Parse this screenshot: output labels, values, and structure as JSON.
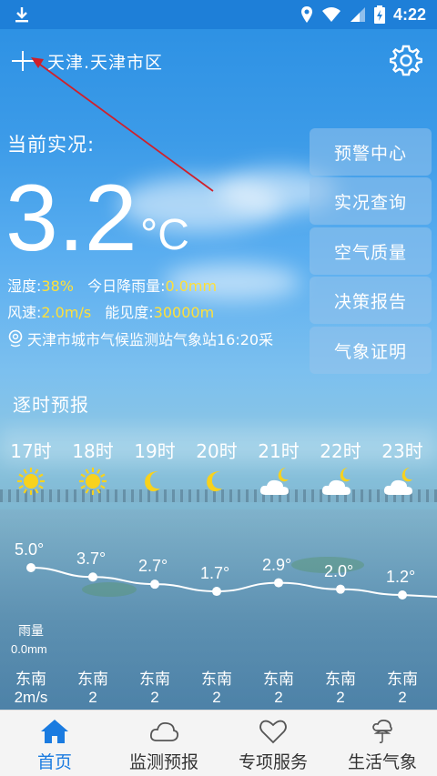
{
  "status_bar": {
    "time": "4:22"
  },
  "header": {
    "location": "天津.天津市区"
  },
  "current": {
    "label": "当前实况:",
    "temperature": "3.2",
    "unit": "°C",
    "humidity_label": "湿度:",
    "humidity_value": "38%",
    "rain_label": "今日降雨量:",
    "rain_value": "0.0mm",
    "wind_label": "风速:",
    "wind_value": "2.0m/s",
    "visibility_label": "能见度:",
    "visibility_value": "30000m",
    "station": "天津市城市气候监测站气象站16:20采"
  },
  "menu": [
    "预警中心",
    "实况查询",
    "空气质量",
    "决策报告",
    "气象证明"
  ],
  "hourly": {
    "title": "逐时预报",
    "hours": [
      {
        "time": "17时",
        "icon": "sun-icon",
        "temp": "5.0°",
        "wind_dir": "东南",
        "wind_speed": "2m/s"
      },
      {
        "time": "18时",
        "icon": "sun-icon",
        "temp": "3.7°",
        "wind_dir": "东南",
        "wind_speed": "2"
      },
      {
        "time": "19时",
        "icon": "moon-icon",
        "temp": "2.7°",
        "wind_dir": "东南",
        "wind_speed": "2"
      },
      {
        "time": "20时",
        "icon": "moon-icon",
        "temp": "1.7°",
        "wind_dir": "东南",
        "wind_speed": "2"
      },
      {
        "time": "21时",
        "icon": "cloudy-night-icon",
        "temp": "2.9°",
        "wind_dir": "东南",
        "wind_speed": "2"
      },
      {
        "time": "22时",
        "icon": "cloudy-night-icon",
        "temp": "2.0°",
        "wind_dir": "东南",
        "wind_speed": "2"
      },
      {
        "time": "23时",
        "icon": "cloudy-night-icon",
        "temp": "1.2°",
        "wind_dir": "东南",
        "wind_speed": "2"
      }
    ],
    "temps_numeric": [
      5.0,
      3.7,
      2.7,
      1.7,
      2.9,
      2.0,
      1.2
    ],
    "rain_label": "雨量",
    "rain_value": "0.0mm"
  },
  "bottom_nav": [
    {
      "label": "首页",
      "icon": "home-icon",
      "active": true
    },
    {
      "label": "监测预报",
      "icon": "cloud-icon",
      "active": false
    },
    {
      "label": "专项服务",
      "icon": "heart-icon",
      "active": false
    },
    {
      "label": "生活气象",
      "icon": "umbrella-icon",
      "active": false
    }
  ],
  "colors": {
    "accent": "#1a7be0",
    "highlight": "#ffe03a",
    "annotation": "#d0202a"
  }
}
